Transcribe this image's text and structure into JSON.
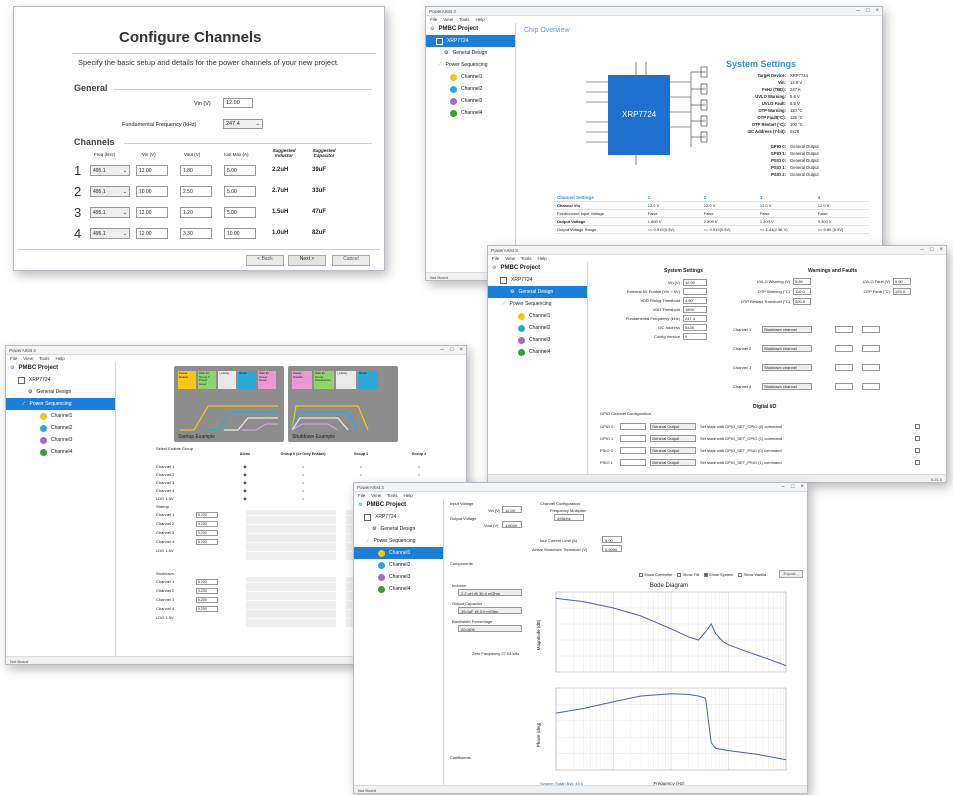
{
  "configure": {
    "title": "Configure Channels",
    "subtitle": "Specify the basic setup and details for the power channels of your new project.",
    "general_heading": "General",
    "vin_label": "Vin (V)",
    "vin_value": "12.00",
    "freq_label": "Fundamental Frequency (kHz)",
    "freq_value": "247.4",
    "channels_heading": "Channels",
    "columns": [
      "Freq (kHz)",
      "Vin (V)",
      "Vout (V)",
      "Iout Max (A)",
      "Suggested Inductor",
      "Suggested Capacitor"
    ],
    "rows": [
      {
        "num": "1",
        "freq": "495.1",
        "vin": "12.00",
        "vout": "1.80",
        "iout": "5.00",
        "ind": "2.2uH",
        "cap": "39uF"
      },
      {
        "num": "2",
        "freq": "495.1",
        "vin": "10.00",
        "vout": "2.50",
        "iout": "5.00",
        "ind": "2.7uH",
        "cap": "33uF"
      },
      {
        "num": "3",
        "freq": "495.1",
        "vin": "12.00",
        "vout": "1.20",
        "iout": "5.00",
        "ind": "1.5uH",
        "cap": "47uF"
      },
      {
        "num": "4",
        "freq": "495.1",
        "vin": "12.00",
        "vout": "3.30",
        "iout": "10.00",
        "ind": "1.0uH",
        "cap": "82uF"
      }
    ],
    "back": "< Back",
    "next": "Next >",
    "cancel": "Cancel"
  },
  "overview": {
    "app_title": "PowerArtist 3",
    "menu": [
      "File",
      "View",
      "Tools",
      "Help"
    ],
    "project": "PMBC Project",
    "device": "XRP7724",
    "tree": [
      "General Design",
      "Power Sequencing",
      "Channel1",
      "Channel2",
      "Channel3",
      "Channel4"
    ],
    "tab": "Chip Overview",
    "chip_label": "XRP7724",
    "settings_title": "System Settings",
    "settings": [
      [
        "Target Device:",
        "XRP7724"
      ],
      [
        "Vin:",
        "12.0 V"
      ],
      [
        "FsHz (TBD):",
        "247 K"
      ],
      [
        "UVLO Warning:",
        "5.6 V"
      ],
      [
        "UVLO Fault:",
        "5.5 V"
      ],
      [
        "OTP Warning:",
        "110 °C"
      ],
      [
        "OTP Fault(°C):",
        "125 °C"
      ],
      [
        "OTP Restart (°C):",
        "100 °C"
      ],
      [
        "I2C Address (7-bit):",
        "0x28"
      ]
    ],
    "gpio": [
      [
        "GPIO 0:",
        "General Output"
      ],
      [
        "GPIO 1:",
        "General Output"
      ],
      [
        "PSIO 0:",
        "General Output"
      ],
      [
        "PSIO 1:",
        "General Output"
      ],
      [
        "PSIO 2:",
        "General Output"
      ]
    ],
    "ch_header": [
      "Channel Settings",
      "1",
      "2",
      "3",
      "4"
    ],
    "ch_rows": [
      [
        "Channel Vin",
        "12.0 V",
        "12.0 V",
        "12.0 V",
        "12.0 V"
      ],
      [
        "Feedforward Input Voltage",
        "False",
        "False",
        "False",
        "False"
      ],
      [
        "Output Voltage",
        "1.800 V",
        "2.500 V",
        "1.200 V",
        "3.300 V"
      ],
      [
        "Output Voltage Range",
        "<= 0.912(0.5V)",
        "<= 0.912(0.5V)",
        "<= 1.44(2.56 V)",
        "<= 0.89 (5.5V)"
      ]
    ],
    "status": "Not Board"
  },
  "general": {
    "project": "PMBC Project",
    "device": "XRP7724",
    "tree": [
      "General Design",
      "Power Sequencing",
      "Channel1",
      "Channel2",
      "Channel3",
      "Channel4"
    ],
    "sys_heading": "System Settings",
    "warn_heading": "Warnings and Faults",
    "fields": [
      [
        "Vin (V)",
        "12.00"
      ],
      [
        "External 5V Enable (Vin = 5V)",
        ""
      ],
      [
        "VDD Rising Threshold",
        "4.80"
      ],
      [
        "VDD Threshold",
        "180V"
      ],
      [
        "Fundamental Frequency (kHz)",
        "247.4"
      ],
      [
        "I2C Address",
        "0x28"
      ],
      [
        "Config Version",
        "0"
      ]
    ],
    "warn_fields": [
      [
        "UVLO Warning (V)",
        "5.60"
      ],
      [
        "UVLO Fault (V)",
        "5.50"
      ],
      [
        "OTP Warning (°C)",
        "110.0"
      ],
      [
        "OTP Fault (°C)",
        "125.0"
      ],
      [
        "OTP Restart Threshold (°C)",
        "100.0"
      ]
    ],
    "digital_heading": "Digital I/O",
    "gpio_heading": "GPIO Channel Configuration",
    "gpio_rows": [
      [
        "GPIO 0",
        "General Output",
        "Set state with GPIO_SET_GPIO (0) command"
      ],
      [
        "GPIO 1",
        "General Output",
        "Set state with GPIO_SET_GPIO (1) command"
      ],
      [
        "PSIO 0",
        "General Output",
        "Set state with GPIO_SET_PSIO (0) command"
      ],
      [
        "PSIO 1",
        "General Output",
        "Set state with GPIO_SET_PSIO (1) command"
      ]
    ],
    "fault_channels": [
      "Channel 1",
      "Channel 2",
      "Channel 3",
      "Channel 4"
    ],
    "fault_value": "Shutdown channel",
    "status": "0.21.5"
  },
  "sequencing": {
    "app_title": "PowerArtist 3",
    "menu": [
      "File",
      "View",
      "Tools",
      "Help"
    ],
    "project": "PMBC Project",
    "device": "XRP7724",
    "tree": [
      "General Design",
      "Power Sequencing",
      "Channel1",
      "Channel2",
      "Channel3",
      "Channel4"
    ],
    "startup_caption": "Startup Example",
    "shutdown_caption": "Shutdown Example",
    "startup_blocks": [
      "Power Enable",
      "Wait for Group 0 Power Good",
      "t_Delay",
      "Ramp",
      "Wait for Power Good"
    ],
    "shutdown_blocks": [
      "Power Disable",
      "Wait for Group Powerdown",
      "t_Delay",
      "Ramp"
    ],
    "enable_label": "Select Enable Group",
    "group_heads": [
      "Alone",
      "Group 0 (or Only Enable)",
      "Group 1",
      "Group 2"
    ],
    "channels": [
      "Channel 1",
      "Channel 2",
      "Channel 3",
      "Channel 4",
      "LDO 1.5V"
    ],
    "startup_label": "Startup",
    "shutdown_label": "Shutdown",
    "delay_values": [
      "0.200",
      "0.200",
      "0.200",
      "0.200"
    ],
    "status": "Not Board"
  },
  "bode": {
    "project": "PMBC Project",
    "device": "XRP7724",
    "tree": [
      "General Design",
      "Power Sequencing",
      "Channel1",
      "Channel2",
      "Channel3",
      "Channel4"
    ],
    "input_voltage": "Input Voltage",
    "vin_label": "Vin (V)",
    "vin_value": "12.00",
    "output_voltage": "Output Voltage",
    "vout_label": "Vout (V)",
    "vout_value": "1.8000",
    "chan_conf": "Channel Configuration",
    "freq_mult": "Frequency Multiplier",
    "freq_mult_value": "495kHz",
    "iout_label": "Iout Current Limit (A)",
    "iout_value": "5.00",
    "active_label": "Active Shutdown Threshold (V)",
    "active_value": "0.5000",
    "components": "Components",
    "inductor": "Inductor",
    "inductor_value": "2.2 uH @ 30.0 mOhm",
    "capacitor": "Output Capacitor",
    "capacitor_value": "39.0uF @ 3.0 mOhm",
    "bandwidth": "Bandwidth Percentage",
    "bandwidth_value": "20.00%",
    "zero_freq": "Zero Frequency 27.03 kHz",
    "coeff": "Coefficients",
    "chart_title": "Bode Diagram",
    "mag_label": "Magnitude (dB)",
    "phase_label": "Phase (deg)",
    "x_label": "Frequency (Hz)",
    "legend_checks": [
      "Show Controller",
      "Show Filt",
      "Show System",
      "Show Vanilla"
    ],
    "export": "Export...",
    "system_caption": "System (Total) BW: 49 k",
    "status": "Not Board"
  },
  "chart_data": [
    {
      "type": "line",
      "title": "Bode Diagram",
      "xlabel": "Frequency (Hz)",
      "ylabel": "Magnitude (dB)",
      "x_scale": "log",
      "xlim": [
        100,
        1000000
      ],
      "ylim": [
        -40,
        60
      ],
      "series": [
        {
          "x": [
            100,
            300,
            1000,
            3000,
            10000,
            20000,
            30000,
            40000,
            50000,
            60000,
            80000,
            100000,
            200000,
            500000,
            1000000
          ],
          "y": [
            52,
            48,
            40,
            30,
            14,
            4,
            0,
            10,
            20,
            8,
            -2,
            -6,
            -14,
            -24,
            -32
          ]
        }
      ]
    },
    {
      "type": "line",
      "title": "",
      "xlabel": "Frequency (Hz)",
      "ylabel": "Phase (deg)",
      "x_scale": "log",
      "xlim": [
        100,
        1000000
      ],
      "ylim": [
        -270,
        90
      ],
      "series": [
        {
          "x": [
            100,
            300,
            1000,
            3000,
            10000,
            20000,
            30000,
            40000,
            45000,
            50000,
            60000,
            100000,
            300000,
            1000000
          ],
          "y": [
            -20,
            0,
            30,
            55,
            65,
            62,
            55,
            45,
            -60,
            -150,
            -175,
            -185,
            -200,
            -225
          ]
        }
      ]
    }
  ]
}
